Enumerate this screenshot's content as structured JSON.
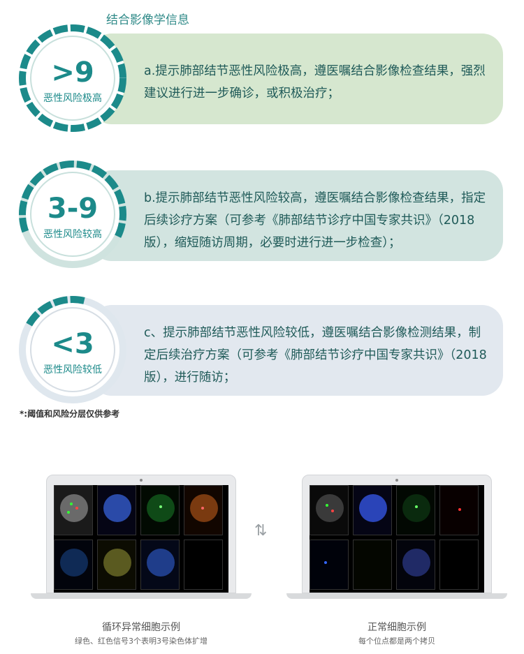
{
  "header": "结合影像学信息",
  "cards": [
    {
      "big": ">9",
      "small": "恶性风险极高",
      "text": "a.提示肺部结节恶性风险极高，遵医嘱结合影像检查结果，强烈建议进行进一步确诊，或积极治疗；"
    },
    {
      "big": "3-9",
      "small": "恶性风险较高",
      "text": "b.提示肺部结节恶性风险较高，遵医嘱结合影像检查结果，指定后续诊疗方案（可参考《肺部结节诊疗中国专家共识》（2018版），缩短随访周期，必要时进行进一步检查）；"
    },
    {
      "big": "<3",
      "small": "恶性风险较低",
      "text": "c、提示肺部结节恶性风险较低，遵医嘱结合影像检测结果，制定后续治疗方案（可参考《肺部结节诊疗中国专家共识》（2018版），进行随访；"
    }
  ],
  "footnote": "*:阈值和风险分层仅供参考",
  "colors": {
    "accent": "#1c8a8a",
    "cardA": "#d6e7cf",
    "cardB": "#d2e4e0",
    "cardC": "#e2e8ef"
  },
  "left_example": {
    "title": "循环异常细胞示例",
    "subtitle": "绿色、红色信号3个表明3号染色体扩增"
  },
  "right_example": {
    "title": "正常细胞示例",
    "subtitle": "每个位点都是两个拷贝"
  },
  "swap_icon": "swap-arrows-icon"
}
